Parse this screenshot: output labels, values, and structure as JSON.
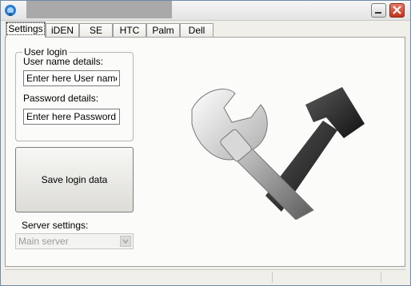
{
  "window": {
    "title": ""
  },
  "tabs": [
    {
      "label": "Settings",
      "active": true
    },
    {
      "label": "iDEN"
    },
    {
      "label": "SE"
    },
    {
      "label": "HTC"
    },
    {
      "label": "Palm"
    },
    {
      "label": "Dell"
    }
  ],
  "login": {
    "group_title": "User login",
    "username_label": "User name details:",
    "username_placeholder": "Enter here User name",
    "password_label": "Password details:",
    "password_placeholder": "Enter here Password"
  },
  "save_button": "Save login data",
  "server": {
    "label": "Server settings:",
    "selected": "Main server"
  },
  "icons": {
    "app": "app-icon",
    "art": "tools-icon",
    "minimize": "minimize-icon",
    "close": "close-icon"
  },
  "colors": {
    "close_red": "#c4331c",
    "panel_bg": "#fbfbf9"
  }
}
